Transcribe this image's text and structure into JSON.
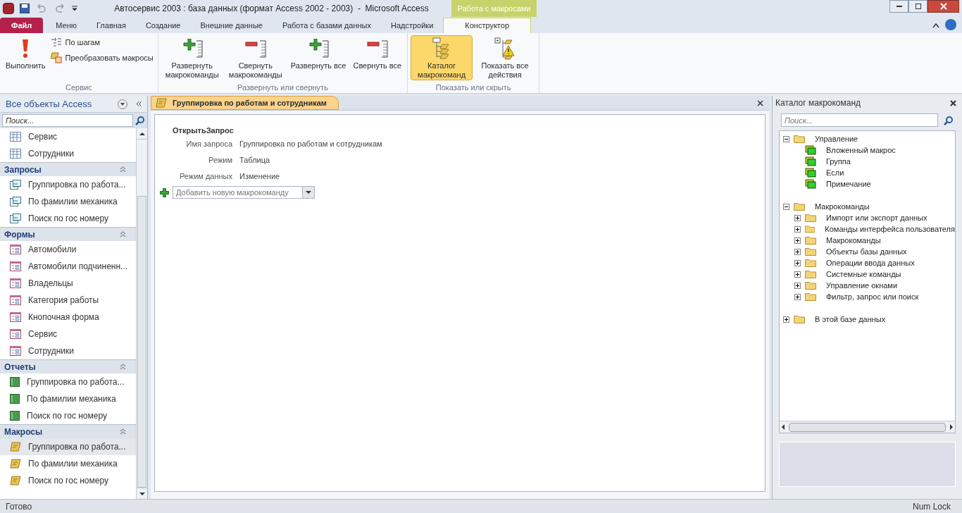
{
  "window": {
    "title": "Автосервис 2003 : база данных (формат Access 2002 - 2003)  -  Microsoft Access",
    "context_tab": "Работа с макросами"
  },
  "menu_tabs": [
    {
      "label": "Файл",
      "kind": "file",
      "selected": false
    },
    {
      "label": "Меню",
      "kind": "tab",
      "selected": false
    },
    {
      "label": "Главная",
      "kind": "tab",
      "selected": false
    },
    {
      "label": "Создание",
      "kind": "tab",
      "selected": false
    },
    {
      "label": "Внешние данные",
      "kind": "tab",
      "selected": false
    },
    {
      "label": "Работа с базами данных",
      "kind": "tab",
      "selected": false
    },
    {
      "label": "Надстройки",
      "kind": "tab",
      "selected": false
    },
    {
      "label": "Конструктор",
      "kind": "tab",
      "selected": true
    }
  ],
  "ribbon_groups": [
    {
      "label": "Сервис",
      "buttons": [
        {
          "label": "Выполнить",
          "kind": "run",
          "selected": false
        }
      ],
      "small_buttons": [
        {
          "label": "По шагам",
          "kind": "step",
          "selected": false
        },
        {
          "label": "Преобразовать макросы",
          "kind": "convert",
          "selected": false
        }
      ]
    },
    {
      "label": "Развернуть или свернуть",
      "buttons": [
        {
          "label": "Развернуть макрокоманды",
          "kind": "expand",
          "selected": false
        },
        {
          "label": "Свернуть макрокоманды",
          "kind": "collapse",
          "selected": false
        },
        {
          "label": "Развернуть все",
          "kind": "expand",
          "selected": false
        },
        {
          "label": "Свернуть все",
          "kind": "collapse",
          "selected": false
        }
      ]
    },
    {
      "label": "Показать или скрыть",
      "buttons": [
        {
          "label": "Каталог макрокоманд",
          "kind": "catalog",
          "selected": true
        },
        {
          "label": "Показать все действия",
          "kind": "warning",
          "selected": false
        }
      ]
    }
  ],
  "nav_pane": {
    "title": "Все объекты Access",
    "search_placeholder": "Поиск...",
    "sections": [
      {
        "kind": "table",
        "items": [
          {
            "label": "Сервис",
            "selected": false
          },
          {
            "label": "Сотрудники",
            "selected": false
          }
        ]
      },
      {
        "title": "Запросы",
        "kind": "query",
        "items": [
          {
            "label": "Группировка по работа...",
            "selected": false
          },
          {
            "label": "По фамилии механика",
            "selected": false
          },
          {
            "label": "Поиск по гос номеру",
            "selected": false
          }
        ]
      },
      {
        "title": "Формы",
        "kind": "form",
        "items": [
          {
            "label": "Автомобили",
            "selected": false
          },
          {
            "label": "Автомобили подчиненн...",
            "selected": false
          },
          {
            "label": "Владельцы",
            "selected": false
          },
          {
            "label": "Категория работы",
            "selected": false
          },
          {
            "label": "Кнопочная форма",
            "selected": false
          },
          {
            "label": "Сервис",
            "selected": false
          },
          {
            "label": "Сотрудники",
            "selected": false
          }
        ]
      },
      {
        "title": "Отчеты",
        "kind": "report",
        "items": [
          {
            "label": "Группировка по работа...",
            "selected": false
          },
          {
            "label": "По фамилии механика",
            "selected": false
          },
          {
            "label": "Поиск по гос номеру",
            "selected": false
          }
        ]
      },
      {
        "title": "Макросы",
        "kind": "macro",
        "items": [
          {
            "label": "Группировка по работа...",
            "selected": true
          },
          {
            "label": "По фамилии механика",
            "selected": false
          },
          {
            "label": "Поиск по гос номеру",
            "selected": false
          }
        ]
      }
    ]
  },
  "document": {
    "tab_title": "Группировка по работам и сотрудникам",
    "action": {
      "name": "ОткрытьЗапрос",
      "arguments": [
        {
          "label": "Имя запроса",
          "value": "Группировка по работам и сотрудникам"
        },
        {
          "label": "Режим",
          "value": "Таблица"
        },
        {
          "label": "Режим данных",
          "value": "Изменение"
        }
      ]
    },
    "add_placeholder": "Добавить новую макрокоманду"
  },
  "catalog": {
    "title": "Каталог макрокоманд",
    "search_placeholder": "Поиск...",
    "tree": [
      {
        "label": "Управление",
        "kind": "folder",
        "expanded": true,
        "children": [
          {
            "label": "Вложенный макрос",
            "kind": "action"
          },
          {
            "label": "Группа",
            "kind": "action"
          },
          {
            "label": "Если",
            "kind": "action"
          },
          {
            "label": "Примечание",
            "kind": "action"
          }
        ]
      },
      {
        "label": "Макрокоманды",
        "kind": "folder",
        "expanded": true,
        "children": [
          {
            "label": "Импорт или экспорт данных",
            "kind": "folder",
            "expanded": false
          },
          {
            "label": "Команды интерфейса пользователя",
            "kind": "folder",
            "expanded": false
          },
          {
            "label": "Макрокоманды",
            "kind": "folder",
            "expanded": false
          },
          {
            "label": "Объекты базы данных",
            "kind": "folder",
            "expanded": false
          },
          {
            "label": "Операции ввода данных",
            "kind": "folder",
            "expanded": false
          },
          {
            "label": "Системные команды",
            "kind": "folder",
            "expanded": false
          },
          {
            "label": "Управление окнами",
            "kind": "folder",
            "expanded": false
          },
          {
            "label": "Фильтр, запрос или поиск",
            "kind": "folder",
            "expanded": false
          }
        ]
      },
      {
        "label": "В этой базе данных",
        "kind": "folder",
        "expanded": false
      }
    ]
  },
  "status_bar": {
    "left": "Готово",
    "right": "Num Lock"
  }
}
